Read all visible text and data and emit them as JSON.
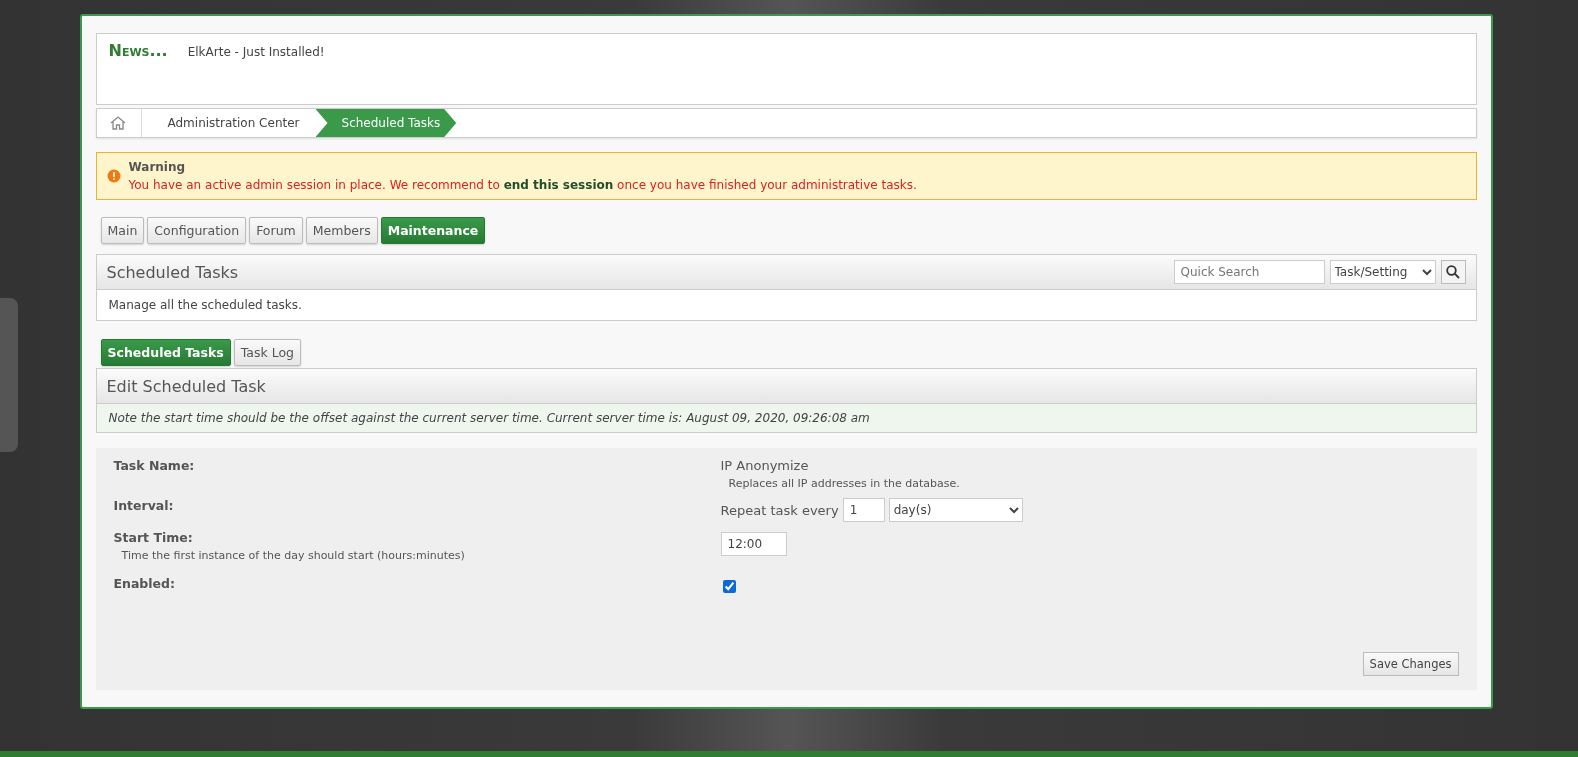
{
  "news": {
    "heading": "News...",
    "text": "ElkArte - Just Installed!"
  },
  "breadcrumbs": [
    {
      "label": "Administration Center",
      "selected": false
    },
    {
      "label": "Scheduled Tasks",
      "selected": true
    }
  ],
  "warning": {
    "title": "Warning",
    "message": "You have an active admin session in place. We recommend to **end this session** once you have finished your administrative tasks."
  },
  "admin_tabs": [
    {
      "label": "Main",
      "selected": false
    },
    {
      "label": "Configuration",
      "selected": false
    },
    {
      "label": "Forum",
      "selected": false
    },
    {
      "label": "Members",
      "selected": false
    },
    {
      "label": "Maintenance",
      "selected": true
    }
  ],
  "section": {
    "title": "Scheduled Tasks",
    "search": {
      "placeholder": "Quick Search",
      "scope": "Task/Setting"
    },
    "description": "Manage all the scheduled tasks."
  },
  "sub_tabs": [
    {
      "label": "Scheduled Tasks",
      "selected": true
    },
    {
      "label": "Task Log",
      "selected": false
    }
  ],
  "edit": {
    "title": "Edit Scheduled Task",
    "note": "Note the start time should be the offset against the current server time. Current server time is: August 09, 2020, 09:26:08 am"
  },
  "form": {
    "rows": [
      {
        "kind": "text",
        "label": "Task Name:",
        "value": "IP Anonymize",
        "description": "Replaces all IP addresses in the database."
      },
      {
        "kind": "interval",
        "label": "Interval:",
        "prefix": "Repeat task every",
        "value": "1",
        "unit": "day(s)"
      },
      {
        "kind": "time",
        "label": "Start Time:",
        "description": "Time the first instance of the day should start (hours:minutes)",
        "value": "12:00"
      },
      {
        "kind": "checkbox",
        "label": "Enabled:",
        "checked": true
      }
    ],
    "submit": "Save Changes"
  }
}
